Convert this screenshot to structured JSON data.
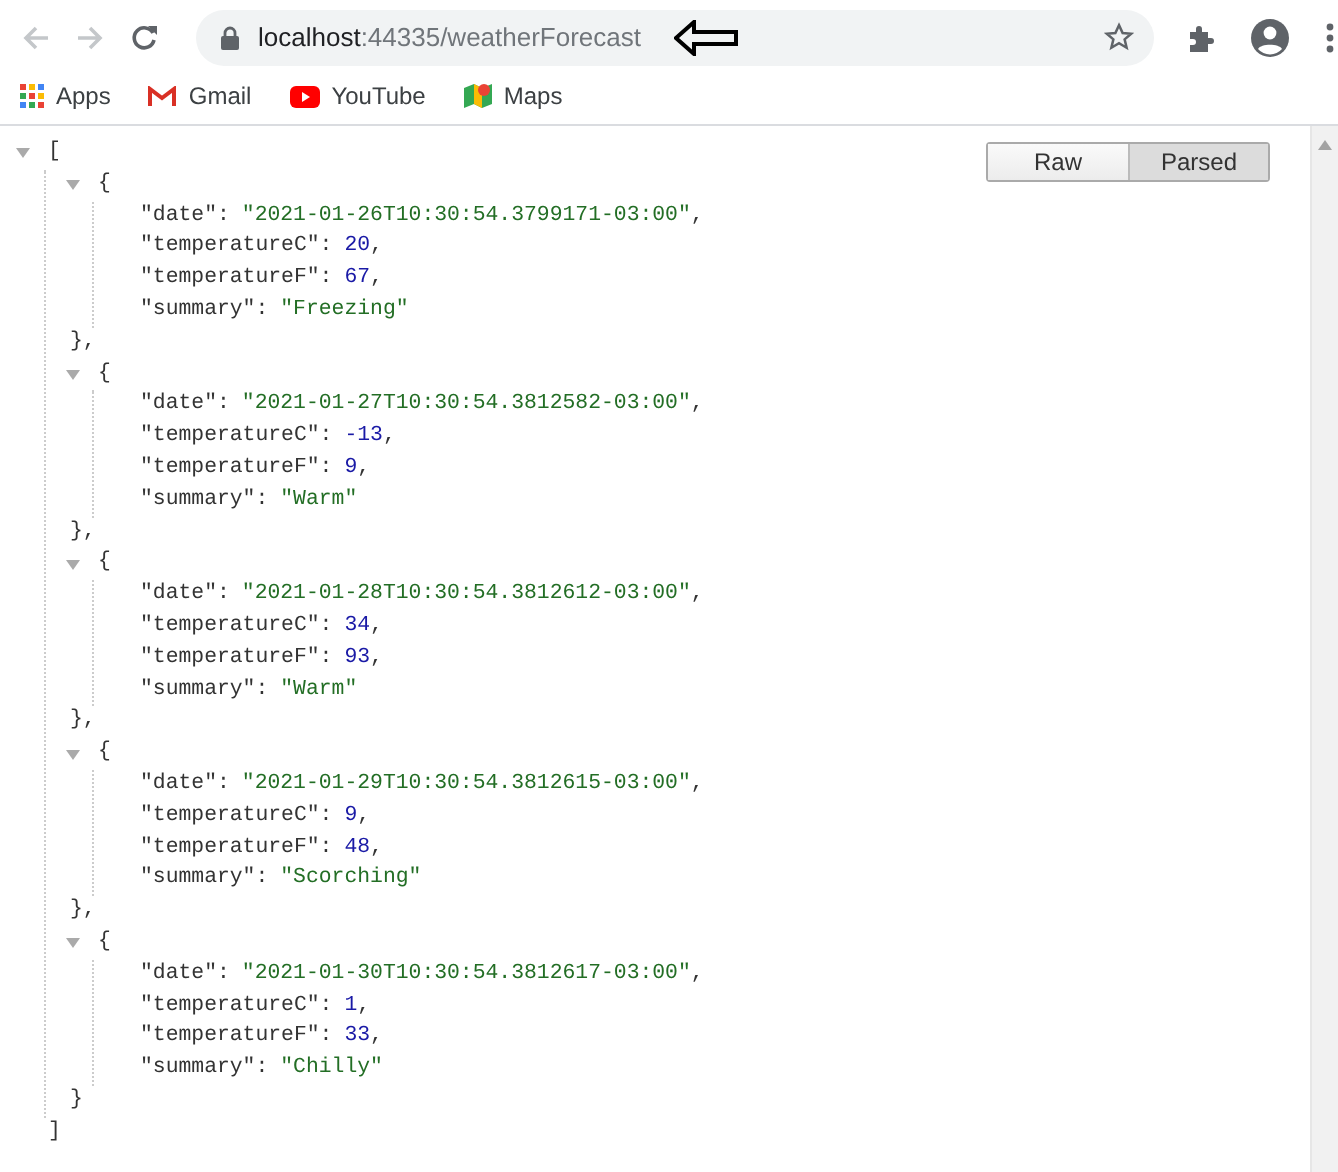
{
  "browser": {
    "back_enabled": false,
    "forward_enabled": false,
    "url_host": "localhost",
    "url_rest": ":44335/weatherForecast"
  },
  "bookmarks": [
    {
      "label": "Apps",
      "kind": "apps"
    },
    {
      "label": "Gmail",
      "kind": "gmail"
    },
    {
      "label": "YouTube",
      "kind": "youtube"
    },
    {
      "label": "Maps",
      "kind": "maps"
    }
  ],
  "view_toggle": [
    {
      "label": "Raw",
      "selected": false
    },
    {
      "label": "Parsed",
      "selected": true
    }
  ],
  "json": {
    "expanded": true,
    "open": "[",
    "close": "]",
    "items": [
      {
        "expanded": true,
        "open": "{",
        "close": "},",
        "props": [
          {
            "key": "\"date\":",
            "value": "\"2021-01-26T10:30:54.3799171-03:00\"",
            "tail": ",",
            "kind": "string"
          },
          {
            "key": "\"temperatureC\":",
            "value": "20",
            "tail": ",",
            "kind": "number"
          },
          {
            "key": "\"temperatureF\":",
            "value": "67",
            "tail": ",",
            "kind": "number"
          },
          {
            "key": "\"summary\":",
            "value": "\"Freezing\"",
            "kind": "string"
          }
        ]
      },
      {
        "expanded": true,
        "open": "{",
        "close": "},",
        "props": [
          {
            "key": "\"date\":",
            "value": "\"2021-01-27T10:30:54.3812582-03:00\"",
            "tail": ",",
            "kind": "string"
          },
          {
            "key": "\"temperatureC\":",
            "value": "-13",
            "tail": ",",
            "kind": "number"
          },
          {
            "key": "\"temperatureF\":",
            "value": "9",
            "tail": ",",
            "kind": "number"
          },
          {
            "key": "\"summary\":",
            "value": "\"Warm\"",
            "kind": "string"
          }
        ]
      },
      {
        "expanded": true,
        "open": "{",
        "close": "},",
        "props": [
          {
            "key": "\"date\":",
            "value": "\"2021-01-28T10:30:54.3812612-03:00\"",
            "tail": ",",
            "kind": "string"
          },
          {
            "key": "\"temperatureC\":",
            "value": "34",
            "tail": ",",
            "kind": "number"
          },
          {
            "key": "\"temperatureF\":",
            "value": "93",
            "tail": ",",
            "kind": "number"
          },
          {
            "key": "\"summary\":",
            "value": "\"Warm\"",
            "kind": "string"
          }
        ]
      },
      {
        "expanded": true,
        "open": "{",
        "close": "},",
        "props": [
          {
            "key": "\"date\":",
            "value": "\"2021-01-29T10:30:54.3812615-03:00\"",
            "tail": ",",
            "kind": "string"
          },
          {
            "key": "\"temperatureC\":",
            "value": "9",
            "tail": ",",
            "kind": "number"
          },
          {
            "key": "\"temperatureF\":",
            "value": "48",
            "tail": ",",
            "kind": "number"
          },
          {
            "key": "\"summary\":",
            "value": "\"Scorching\"",
            "kind": "string"
          }
        ]
      },
      {
        "expanded": true,
        "open": "{",
        "close": "}",
        "props": [
          {
            "key": "\"date\":",
            "value": "\"2021-01-30T10:30:54.3812617-03:00\"",
            "tail": ",",
            "kind": "string"
          },
          {
            "key": "\"temperatureC\":",
            "value": "1",
            "tail": ",",
            "kind": "number"
          },
          {
            "key": "\"temperatureF\":",
            "value": "33",
            "tail": ",",
            "kind": "number"
          },
          {
            "key": "\"summary\":",
            "value": "\"Chilly\"",
            "kind": "string"
          }
        ]
      }
    ]
  }
}
